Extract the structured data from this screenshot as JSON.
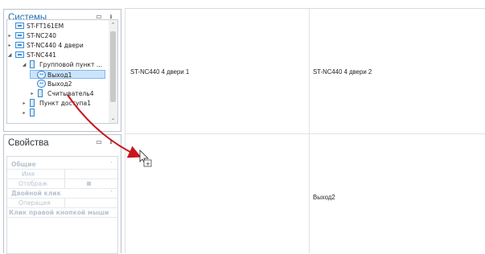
{
  "systems_panel": {
    "title": "Системы",
    "window_btn": "▭",
    "pin_btn": "ᵻ",
    "tree": [
      {
        "label": "ST-FT161EM"
      },
      {
        "label": "ST-NC240"
      },
      {
        "label": "ST-NC440 4 двери"
      },
      {
        "label": "ST-NC441"
      },
      {
        "label": "Групповой пункт ..."
      },
      {
        "label": "Выход1"
      },
      {
        "label": "Выход2"
      },
      {
        "label": "Считыватель4"
      },
      {
        "label": "Пункт доступа1"
      }
    ]
  },
  "properties_panel": {
    "title": "Свойства",
    "window_btn": "▭",
    "pin_btn": "ᵻ",
    "rows": [
      {
        "label": "Общие"
      },
      {
        "label": "Имя"
      },
      {
        "label": "Отображ"
      },
      {
        "label": "Двойной клик"
      },
      {
        "label": "Операция"
      },
      {
        "label": "Клик правой кнопкой мыши"
      }
    ]
  },
  "grid": {
    "cells": [
      {
        "text": "ST-NC440 4 двери 1"
      },
      {
        "text": "ST-NC440 4 двери 2"
      },
      {
        "text": ""
      },
      {
        "text": "Выход2"
      }
    ]
  },
  "colors": {
    "arrow": "#c8161d",
    "selection": "#cce4fb",
    "panel_title": "#1f6fb8"
  }
}
